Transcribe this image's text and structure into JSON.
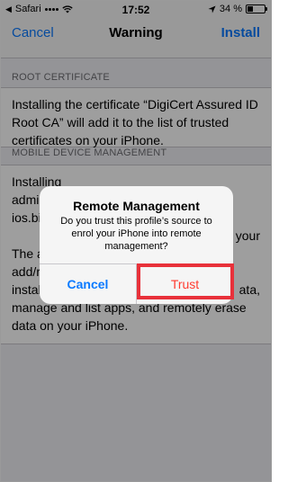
{
  "status_bar": {
    "carrier": "Safari",
    "time": "17:52",
    "battery": "34 %",
    "battery_level": 0.34
  },
  "nav": {
    "left": "Cancel",
    "title": "Warning",
    "right": "Install"
  },
  "sections": [
    {
      "header": "ROOT CERTIFICATE",
      "lines": [
        "Installing the certificate “DigiCert Assured ID",
        "Root CA” will add it to the list of trusted",
        "certificates on your iPhone."
      ]
    },
    {
      "header": "MOBILE DEVICE MANAGEMENT",
      "lines": [
        "Installing",
        "admin",
        "ios.bit",
        "",
        "The a",
        "add/remove accounts and restrictions, install,",
        "manage and list apps, and remotely erase",
        "data on your iPhone."
      ],
      "right_fragments": [
        "your",
        "ata,"
      ]
    }
  ],
  "alert": {
    "title": "Remote Management",
    "message_lines": [
      "Do you trust this profile’s source to",
      "enrol your iPhone into remote",
      "management?"
    ],
    "cancel": "Cancel",
    "trust": "Trust"
  }
}
